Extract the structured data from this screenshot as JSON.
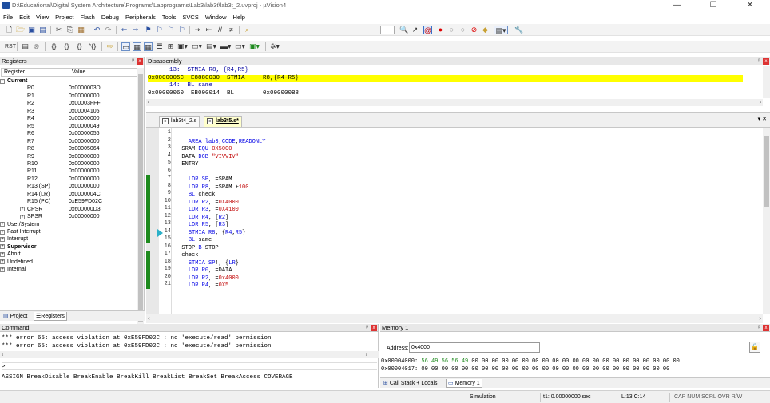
{
  "window": {
    "title": "D:\\Educational\\Digital System Architecture\\Programs\\Labprograms\\Lab3\\lab3t\\lab3t_2.uvproj - µVision4",
    "minimize": "—",
    "maximize": "☐",
    "close": "✕"
  },
  "menu": [
    "File",
    "Edit",
    "View",
    "Project",
    "Flash",
    "Debug",
    "Peripherals",
    "Tools",
    "SVCS",
    "Window",
    "Help"
  ],
  "registers": {
    "panel_title": "Registers",
    "col_register": "Register",
    "col_value": "Value",
    "group_current": "Current",
    "rows": [
      {
        "name": "R0",
        "value": "0x0000003D"
      },
      {
        "name": "R1",
        "value": "0x00000000"
      },
      {
        "name": "R2",
        "value": "0x00003FFF"
      },
      {
        "name": "R3",
        "value": "0x00004105"
      },
      {
        "name": "R4",
        "value": "0x00000000"
      },
      {
        "name": "R5",
        "value": "0x00000049"
      },
      {
        "name": "R6",
        "value": "0x00000056"
      },
      {
        "name": "R7",
        "value": "0x00000000"
      },
      {
        "name": "R8",
        "value": "0x00005064"
      },
      {
        "name": "R9",
        "value": "0x00000000"
      },
      {
        "name": "R10",
        "value": "0x00000000"
      },
      {
        "name": "R11",
        "value": "0x00000000"
      },
      {
        "name": "R12",
        "value": "0x00000000"
      },
      {
        "name": "R13 (SP)",
        "value": "0x00000000"
      },
      {
        "name": "R14 (LR)",
        "value": "0x0000004C"
      },
      {
        "name": "R15 (PC)",
        "value": "0xE59FD02C"
      },
      {
        "name": "CPSR",
        "value": "0x600000D3"
      },
      {
        "name": "SPSR",
        "value": "0x00000000"
      }
    ],
    "groups": [
      "User/System",
      "Fast Interrupt",
      "Interrupt",
      "Supervisor",
      "Abort",
      "Undefined",
      "Internal"
    ],
    "tab_project": "Project",
    "tab_registers": "Registers"
  },
  "disassembly": {
    "panel_title": "Disassembly",
    "lines": [
      "      13:  STMIA R8, {R4,R5}",
      "0x0000005C  E8880030  STMIA     R8,{R4-R5}",
      "      14:  BL same",
      "0x00000060  EB000014  BL        0x000000B8"
    ]
  },
  "editor": {
    "tabs": [
      "lab3t4_2.s",
      "lab3t5.s*"
    ],
    "line_numbers": [
      "1",
      "2",
      "3",
      "4",
      "5",
      "6",
      "7",
      "8",
      "9",
      "10",
      "11",
      "12",
      "13",
      "14",
      "15",
      "16",
      "17",
      "18",
      "19",
      "20",
      "21"
    ],
    "code": [
      [],
      [
        {
          "t": "    AREA lab3,",
          "c": "kw"
        },
        {
          "t": "CODE",
          "c": "kw"
        },
        {
          "t": ",",
          "c": ""
        },
        {
          "t": "READONLY",
          "c": "kw"
        }
      ],
      [
        {
          "t": "  SRAM ",
          "c": ""
        },
        {
          "t": "EQU",
          "c": "kw"
        },
        {
          "t": " ",
          "c": ""
        },
        {
          "t": "0X5000",
          "c": "num"
        }
      ],
      [
        {
          "t": "  DATA ",
          "c": ""
        },
        {
          "t": "DCB",
          "c": "kw"
        },
        {
          "t": " ",
          "c": ""
        },
        {
          "t": "\"VIVVIV\"",
          "c": "str"
        }
      ],
      [
        {
          "t": "  ENTRY",
          "c": ""
        }
      ],
      [],
      [
        {
          "t": "    ",
          "c": ""
        },
        {
          "t": "LDR",
          "c": "kw"
        },
        {
          "t": " ",
          "c": ""
        },
        {
          "t": "SP",
          "c": "kw"
        },
        {
          "t": ", =SRAM",
          "c": ""
        }
      ],
      [
        {
          "t": "    ",
          "c": ""
        },
        {
          "t": "LDR",
          "c": "kw"
        },
        {
          "t": " ",
          "c": ""
        },
        {
          "t": "R8",
          "c": "kw"
        },
        {
          "t": ", =SRAM +",
          "c": ""
        },
        {
          "t": "100",
          "c": "num"
        }
      ],
      [
        {
          "t": "    ",
          "c": ""
        },
        {
          "t": "BL",
          "c": "kw"
        },
        {
          "t": " check",
          "c": ""
        }
      ],
      [
        {
          "t": "    ",
          "c": ""
        },
        {
          "t": "LDR",
          "c": "kw"
        },
        {
          "t": " ",
          "c": ""
        },
        {
          "t": "R2",
          "c": "kw"
        },
        {
          "t": ", =",
          "c": ""
        },
        {
          "t": "0X4000",
          "c": "num"
        }
      ],
      [
        {
          "t": "    ",
          "c": ""
        },
        {
          "t": "LDR",
          "c": "kw"
        },
        {
          "t": " ",
          "c": ""
        },
        {
          "t": "R3",
          "c": "kw"
        },
        {
          "t": ", =",
          "c": ""
        },
        {
          "t": "0X4100",
          "c": "num"
        }
      ],
      [
        {
          "t": "    ",
          "c": ""
        },
        {
          "t": "LDR",
          "c": "kw"
        },
        {
          "t": " ",
          "c": ""
        },
        {
          "t": "R4",
          "c": "kw"
        },
        {
          "t": ", [",
          "c": ""
        },
        {
          "t": "R2",
          "c": "kw"
        },
        {
          "t": "]",
          "c": ""
        }
      ],
      [
        {
          "t": "    ",
          "c": ""
        },
        {
          "t": "LDR",
          "c": "kw"
        },
        {
          "t": " ",
          "c": ""
        },
        {
          "t": "R5",
          "c": "kw"
        },
        {
          "t": ", [",
          "c": ""
        },
        {
          "t": "R3",
          "c": "kw"
        },
        {
          "t": "]",
          "c": ""
        }
      ],
      [
        {
          "t": "    ",
          "c": ""
        },
        {
          "t": "STMIA",
          "c": "kw"
        },
        {
          "t": " ",
          "c": ""
        },
        {
          "t": "R8",
          "c": "kw"
        },
        {
          "t": ", {",
          "c": ""
        },
        {
          "t": "R4",
          "c": "kw"
        },
        {
          "t": ",",
          "c": ""
        },
        {
          "t": "R5",
          "c": "kw"
        },
        {
          "t": "}",
          "c": ""
        }
      ],
      [
        {
          "t": "    ",
          "c": ""
        },
        {
          "t": "BL",
          "c": "kw"
        },
        {
          "t": " same",
          "c": ""
        }
      ],
      [
        {
          "t": "  STOP ",
          "c": ""
        },
        {
          "t": "B",
          "c": "kw"
        },
        {
          "t": " STOP",
          "c": ""
        }
      ],
      [
        {
          "t": "  check",
          "c": ""
        }
      ],
      [
        {
          "t": "    ",
          "c": ""
        },
        {
          "t": "STMIA",
          "c": "kw"
        },
        {
          "t": " ",
          "c": ""
        },
        {
          "t": "SP",
          "c": "kw"
        },
        {
          "t": "!, {",
          "c": ""
        },
        {
          "t": "LR",
          "c": "kw"
        },
        {
          "t": "}",
          "c": ""
        }
      ],
      [
        {
          "t": "    ",
          "c": ""
        },
        {
          "t": "LDR",
          "c": "kw"
        },
        {
          "t": " ",
          "c": ""
        },
        {
          "t": "R0",
          "c": "kw"
        },
        {
          "t": ", =DATA",
          "c": ""
        }
      ],
      [
        {
          "t": "    ",
          "c": ""
        },
        {
          "t": "LDR",
          "c": "kw"
        },
        {
          "t": " ",
          "c": ""
        },
        {
          "t": "R2",
          "c": "kw"
        },
        {
          "t": ", =",
          "c": ""
        },
        {
          "t": "0x4000",
          "c": "num"
        }
      ],
      [
        {
          "t": "    ",
          "c": ""
        },
        {
          "t": "LDR",
          "c": "kw"
        },
        {
          "t": " ",
          "c": ""
        },
        {
          "t": "R4",
          "c": "kw"
        },
        {
          "t": ", =",
          "c": ""
        },
        {
          "t": "0X5",
          "c": "num"
        }
      ]
    ]
  },
  "command": {
    "panel_title": "Command",
    "lines": [
      "*** error 65: access violation at 0xE59FD02C : no 'execute/read' permission",
      "*** error 65: access violation at 0xE59FD02C : no 'execute/read' permission"
    ],
    "prompt": ">",
    "help": "ASSIGN BreakDisable BreakEnable BreakKill BreakList BreakSet BreakAccess COVERAGE"
  },
  "memory": {
    "panel_title": "Memory 1",
    "address_label": "Address:",
    "address_value": "0x4000",
    "lines": [
      {
        "addr": "0x00004000:",
        "data": " 56 49 56 56 49",
        "rest": " 00 00 00 00 00 00 00 00 00 00 00 00 00 00 00 00 00 00 00 00 00"
      },
      {
        "addr": "0x00004017:",
        "data": "",
        "rest": " 00 00 00 00 00 00 00 00 00 00 00 00 00 00 00 00 00 00 00 00 00 00 00 00 00"
      }
    ],
    "tab_callstack": "Call Stack + Locals",
    "tab_memory": "Memory 1"
  },
  "status": {
    "mode": "Simulation",
    "time": "t1: 0.00000000 sec",
    "position": "L:13 C:14",
    "indicators": "CAP  NUM  SCRL  OVR  R/W"
  },
  "colors": {
    "current_line": "#ffff00",
    "coverage": "#1e8a1e",
    "keyword": "#0000e6",
    "string": "#c00000"
  }
}
